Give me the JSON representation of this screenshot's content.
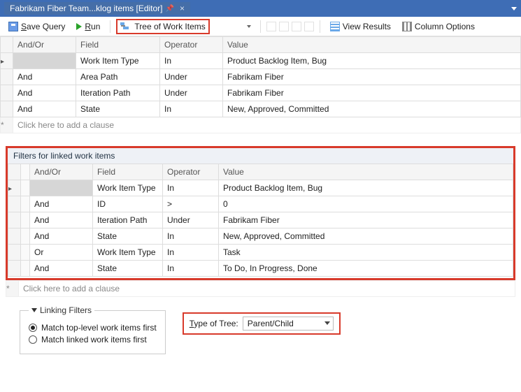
{
  "titlebar": {
    "tab_label": "Fabrikam Fiber Team...klog items [Editor]"
  },
  "toolbar": {
    "save_label": "Save Query",
    "run_label": "Run",
    "tree_label": "Tree of Work Items",
    "view_results_label": "View Results",
    "column_options_label": "Column Options"
  },
  "headers": {
    "andor": "And/Or",
    "field": "Field",
    "operator": "Operator",
    "value": "Value"
  },
  "top_clauses": [
    {
      "andor": "",
      "field": "Work Item Type",
      "operator": "In",
      "value": "Product Backlog Item, Bug",
      "selected": true
    },
    {
      "andor": "And",
      "field": "Area Path",
      "operator": "Under",
      "value": "Fabrikam Fiber"
    },
    {
      "andor": "And",
      "field": "Iteration Path",
      "operator": "Under",
      "value": "Fabrikam Fiber"
    },
    {
      "andor": "And",
      "field": "State",
      "operator": "In",
      "value": "New, Approved, Committed"
    }
  ],
  "add_clause_hint": "Click here to add a clause",
  "linked": {
    "title": "Filters for linked work items",
    "clauses": [
      {
        "andor": "",
        "field": "Work Item Type",
        "operator": "In",
        "value": "Product Backlog Item, Bug",
        "selected": true
      },
      {
        "andor": "And",
        "field": "ID",
        "operator": ">",
        "value": "0"
      },
      {
        "andor": "And",
        "field": "Iteration Path",
        "operator": "Under",
        "value": "Fabrikam Fiber"
      },
      {
        "andor": "And",
        "field": "State",
        "operator": "In",
        "value": "New, Approved, Committed"
      },
      {
        "andor": "Or",
        "field": "Work Item Type",
        "operator": "In",
        "value": "Task"
      },
      {
        "andor": "And",
        "field": "State",
        "operator": "In",
        "value": "To Do, In Progress, Done"
      }
    ]
  },
  "linking": {
    "legend": "Linking Filters",
    "radio_top": "Match top-level work items first",
    "radio_linked": "Match linked work items first",
    "tot_label": "Type of Tree:",
    "tot_value": "Parent/Child"
  }
}
